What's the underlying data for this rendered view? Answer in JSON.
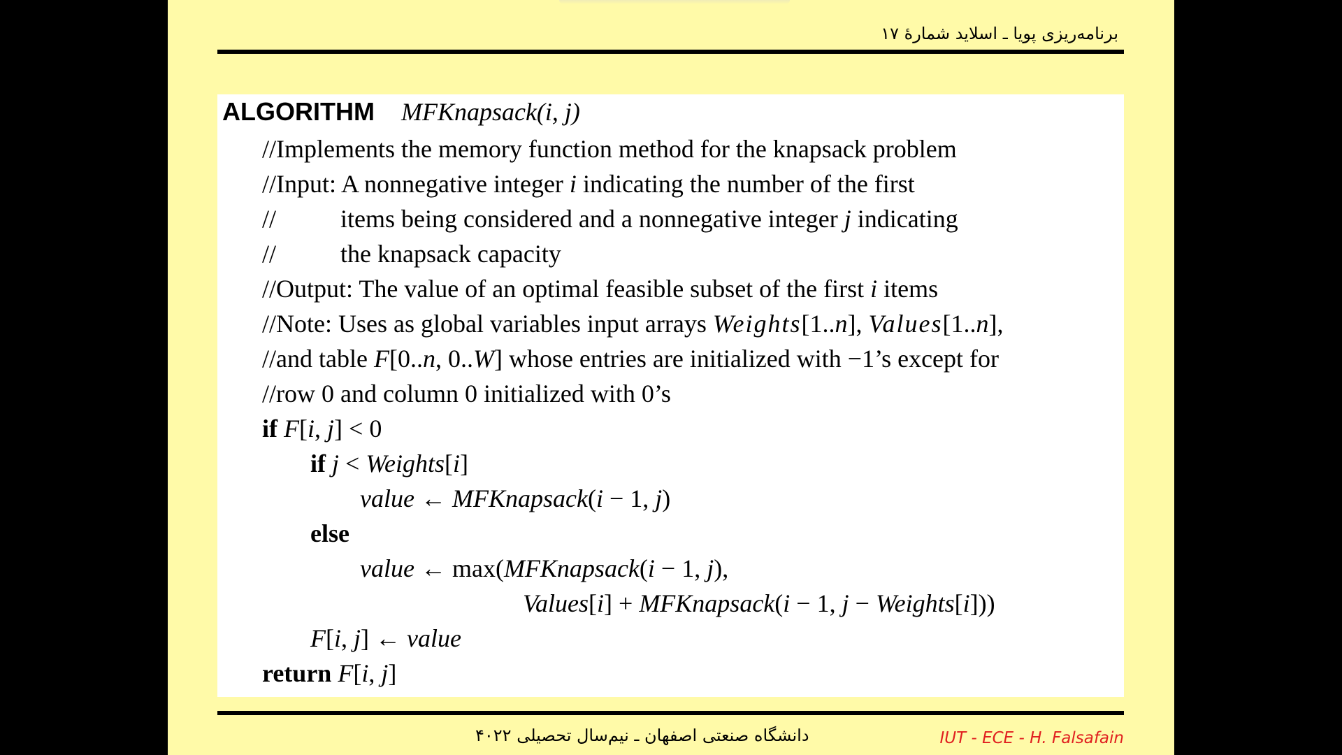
{
  "header": {
    "title": "برنامه‌ریزی پویا ـ اسلاید شمارهٔ ۱۷"
  },
  "algorithm": {
    "keyword": "ALGORITHM",
    "signature": "MFKnapsack(i, j)",
    "lines": [
      "//Implements the memory function method for the knapsack problem",
      "//Input: A nonnegative integer ",
      "i",
      " indicating the number of the first",
      "//",
      "items being considered and a nonnegative integer ",
      "j",
      " indicating",
      "//",
      "the knapsack capacity",
      "//Output: The value of an optimal feasible subset of the first ",
      "i",
      " items",
      "//Note: Uses as global variables input arrays ",
      "Weights",
      "[1..",
      "n",
      "], ",
      "Values",
      "[1..",
      "n",
      "],",
      "//and table ",
      "F",
      "[0..",
      "n",
      ", 0..",
      "W",
      "] whose entries are initialized with −1’s except for",
      "//row 0 and column 0 initialized with 0’s"
    ],
    "code": {
      "if1_kw": "if",
      "if1_F": "F",
      "if1_open": "[",
      "if1_i": "i",
      "if1_comma": ", ",
      "if1_j": "j",
      "if1_rest": "] < 0",
      "if2_kw": "if",
      "if2_j": "j",
      "if2_lt": " < ",
      "if2_weights": "Weights",
      "if2_open": "[",
      "if2_i": "i",
      "if2_close": "]",
      "v1_value": "value",
      "v1_arrow": " ← ",
      "v1_call": "MFKnapsack",
      "v1_open": "(",
      "v1_i": "i",
      "v1_mid": " − 1, ",
      "v1_j": "j",
      "v1_close": ")",
      "else_kw": "else",
      "v2_value": "value",
      "v2_arrow": " ← max(",
      "v2_call": "MFKnapsack",
      "v2_open": "(",
      "v2_i": "i",
      "v2_mid": " − 1, ",
      "v2_j": "j",
      "v2_close": "),",
      "v3_values": "Values",
      "v3_open": "[",
      "v3_i": "i",
      "v3_plus": "] + ",
      "v3_call": "MFKnapsack",
      "v3_open2": "(",
      "v3_i2": "i",
      "v3_mid": " − 1, ",
      "v3_j": "j",
      "v3_minus": " − ",
      "v3_weights": "Weights",
      "v3_open3": "[",
      "v3_i3": "i",
      "v3_close": "]))",
      "asg_F": "F",
      "asg_open": "[",
      "asg_i": "i",
      "asg_comma": ", ",
      "asg_j": "j",
      "asg_arrow": "] ← ",
      "asg_value": "value",
      "ret_kw": "return",
      "ret_F": "F",
      "ret_open": "[",
      "ret_i": "i",
      "ret_comma": ", ",
      "ret_j": "j",
      "ret_close": "]"
    }
  },
  "footer": {
    "university": "دانشگاه صنعتی اصفهان ـ نیم‌سال تحصیلی ۴۰۲۲",
    "credit": "IUT - ECE - H. Falsafain"
  },
  "colors": {
    "slide_background": "#fffaa8",
    "credit": "#e02020"
  }
}
